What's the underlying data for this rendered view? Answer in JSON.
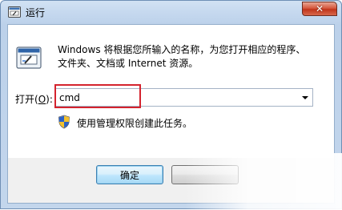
{
  "window": {
    "title": "运行"
  },
  "description": {
    "line1": "Windows 将根据您所输入的名称，为您打开相应的程序、",
    "line2": "文件夹、文档或 Internet 资源。"
  },
  "open_field": {
    "label_prefix": "打开(",
    "label_accel": "O",
    "label_suffix": "):",
    "value": "cmd"
  },
  "admin_note": "使用管理权限创建此任务。",
  "buttons": {
    "ok_label": "确定"
  },
  "colors": {
    "highlight": "#d4232e",
    "close_button": "#c43c23"
  }
}
